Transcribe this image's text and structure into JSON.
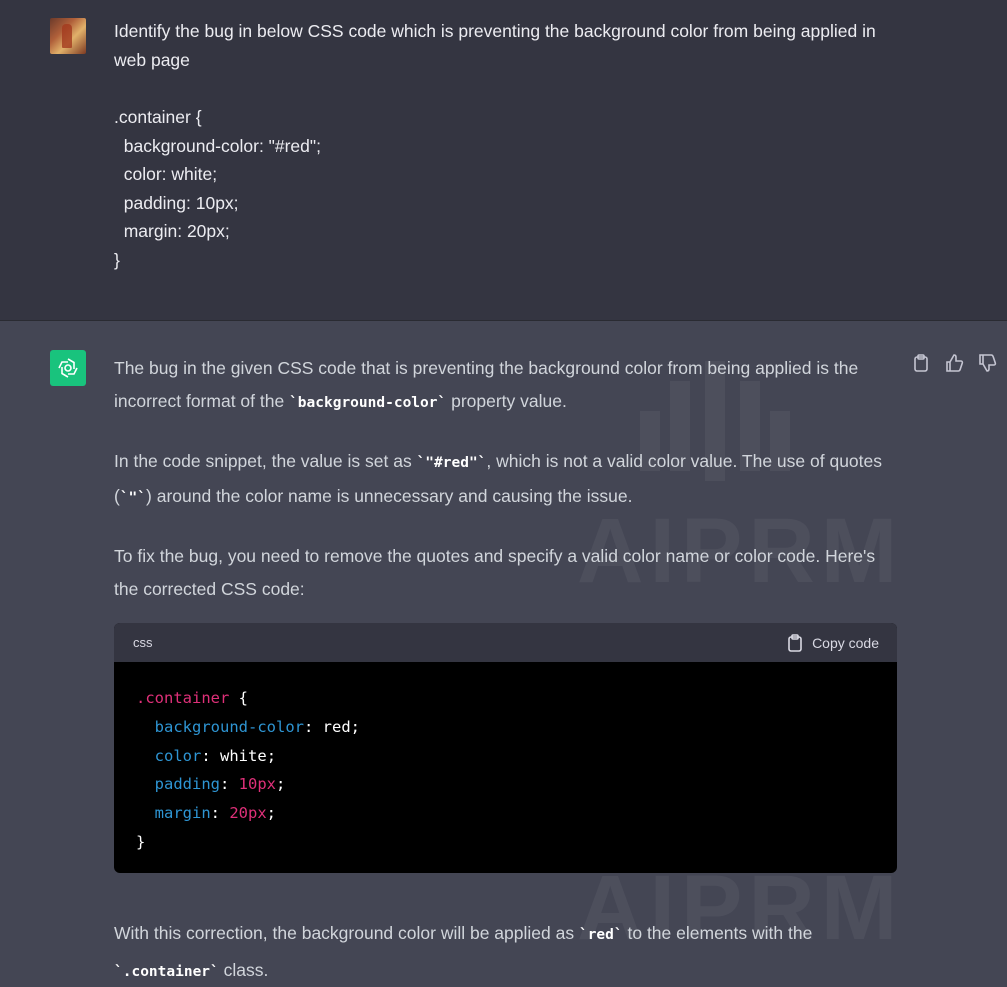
{
  "user_message": {
    "prompt": "Identify the bug in below CSS code which is preventing the background color from being applied in web page",
    "code_lines": [
      ".container {",
      "  background-color: \"#red\";",
      "  color: white;",
      "  padding: 10px;",
      "  margin: 20px;",
      "}"
    ]
  },
  "assistant_message": {
    "p1_a": "The bug in the given CSS code that is preventing the background color from being applied is the incorrect format of the ",
    "p1_code": "`background-color`",
    "p1_b": " property value.",
    "p2_a": "In the code snippet, the value is set as ",
    "p2_code1": "`\"#red\"`",
    "p2_b": ", which is not a valid color value. The use of quotes (",
    "p2_code2": "`\"`",
    "p2_c": ") around the color name is unnecessary and causing the issue.",
    "p3": "To fix the bug, you need to remove the quotes and specify a valid color name or color code. Here's the corrected CSS code:",
    "code_block": {
      "language": "css",
      "copy_label": "Copy code",
      "selector": ".container",
      "brace_open": " {",
      "decls": [
        {
          "prop": "background-color",
          "value": "red"
        },
        {
          "prop": "color",
          "value": "white"
        },
        {
          "prop": "padding",
          "value": "10px"
        },
        {
          "prop": "margin",
          "value": "20px"
        }
      ],
      "brace_close": "}"
    },
    "p4_a": "With this correction, the background color will be applied as ",
    "p4_code1": "`red`",
    "p4_b": " to the elements with the ",
    "p4_code2": "`.container`",
    "p4_c": " class."
  },
  "watermark_text": "AIPRM",
  "icons": {
    "copy": "clipboard-icon",
    "like": "thumbs-up-icon",
    "dislike": "thumbs-down-icon",
    "bot": "openai-logo-icon"
  }
}
